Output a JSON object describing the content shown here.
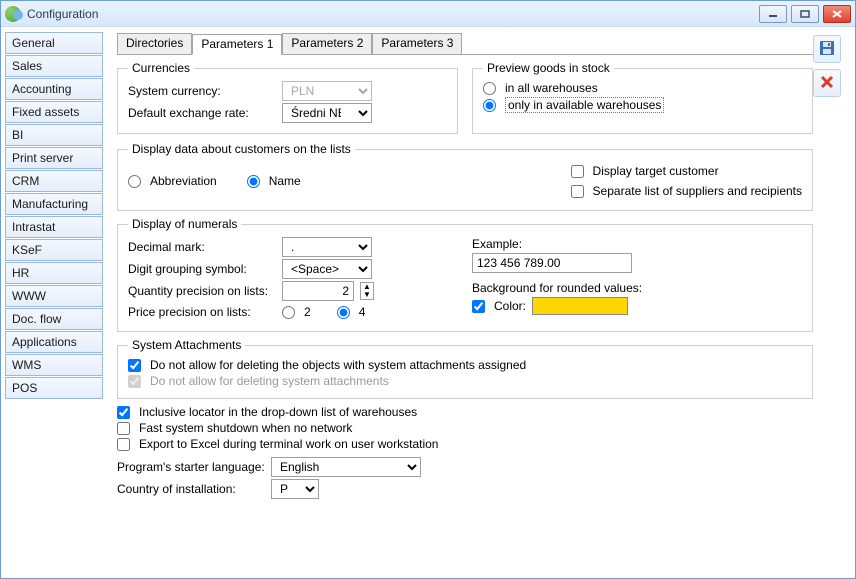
{
  "window": {
    "title": "Configuration"
  },
  "sidebar": {
    "items": [
      {
        "label": "General"
      },
      {
        "label": "Sales"
      },
      {
        "label": "Accounting"
      },
      {
        "label": "Fixed assets"
      },
      {
        "label": "BI"
      },
      {
        "label": "Print server"
      },
      {
        "label": "CRM"
      },
      {
        "label": "Manufacturing"
      },
      {
        "label": "Intrastat"
      },
      {
        "label": "KSeF"
      },
      {
        "label": "HR"
      },
      {
        "label": "WWW"
      },
      {
        "label": "Doc. flow"
      },
      {
        "label": "Applications"
      },
      {
        "label": "WMS"
      },
      {
        "label": "POS"
      }
    ]
  },
  "tabs": [
    {
      "label": "Directories"
    },
    {
      "label": "Parameters 1"
    },
    {
      "label": "Parameters 2"
    },
    {
      "label": "Parameters 3"
    }
  ],
  "currencies": {
    "legend": "Currencies",
    "system_label": "System currency:",
    "system_value": "PLN",
    "rate_label": "Default exchange rate:",
    "rate_value": "Średni NBP"
  },
  "preview": {
    "legend": "Preview goods in stock",
    "opt_all": "in all warehouses",
    "opt_available": "only in available warehouses",
    "selected": "available"
  },
  "display_customers": {
    "legend": "Display data about customers on the lists",
    "opt_abbrev": "Abbreviation",
    "opt_name": "Name",
    "selected": "name",
    "chk_target": "Display target customer",
    "chk_separate": "Separate list of suppliers and recipients",
    "target_checked": false,
    "separate_checked": false
  },
  "numerals": {
    "legend": "Display of numerals",
    "decimal_label": "Decimal mark:",
    "decimal_value": ".",
    "group_label": "Digit grouping symbol:",
    "group_value": "<Space>",
    "qty_label": "Quantity precision on lists:",
    "qty_value": "2",
    "price_label": "Price precision on lists:",
    "price_opt2": "2",
    "price_opt4": "4",
    "price_selected": "4",
    "example_label": "Example:",
    "example_value": "123 456 789.00",
    "bg_label": "Background for rounded values:",
    "color_label": "Color:",
    "color_value": "#ffd600",
    "color_checked": true
  },
  "attachments": {
    "legend": "System Attachments",
    "chk1": "Do not allow for deleting the objects with system attachments assigned",
    "chk1_checked": true,
    "chk2": "Do not allow for deleting system attachments",
    "chk2_checked": true
  },
  "misc": {
    "chk_locator": "Inclusive locator in the drop-down list of warehouses",
    "chk_locator_checked": true,
    "chk_shutdown": "Fast system shutdown when no network",
    "chk_shutdown_checked": false,
    "chk_export": "Export to Excel during terminal work on user workstation",
    "chk_export_checked": false
  },
  "lang": {
    "starter_label": "Program's starter language:",
    "starter_value": "English",
    "country_label": "Country of installation:",
    "country_value": "PL"
  }
}
